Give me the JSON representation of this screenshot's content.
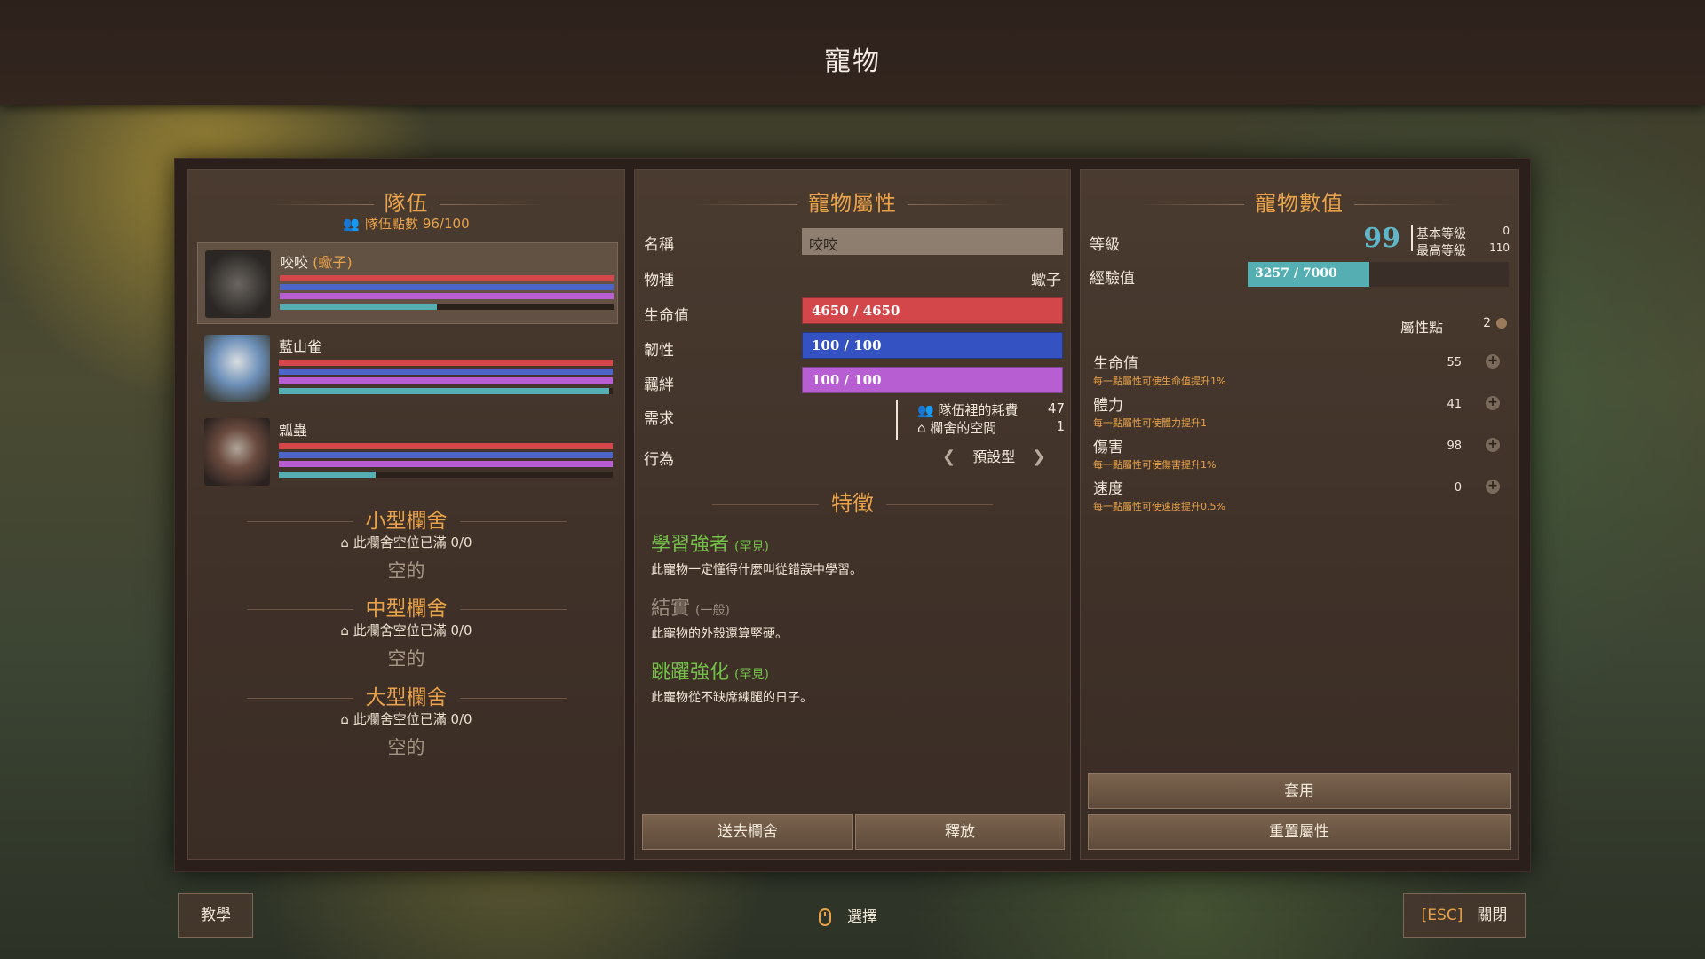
{
  "title": "寵物",
  "team": {
    "heading": "隊伍",
    "points_label": "隊伍點數",
    "points_value": "96/100",
    "pets": [
      {
        "name": "咬咬",
        "species": "(蠍子)",
        "hp": 1.0,
        "toughness": 1.0,
        "bond": 1.0,
        "xp": 0.47,
        "thumb_color": "#55504a"
      },
      {
        "name": "藍山雀",
        "species": "",
        "hp": 1.0,
        "toughness": 1.0,
        "bond": 1.0,
        "xp": 0.99,
        "thumb_color": "#6c8fb8"
      },
      {
        "name": "瓢蟲",
        "species": "",
        "hp": 1.0,
        "toughness": 1.0,
        "bond": 1.0,
        "xp": 0.29,
        "thumb_color": "#6a4a3e"
      }
    ],
    "pens": [
      {
        "title": "小型欄舍",
        "status": "此欄舍空位已滿 0/0",
        "empty": "空的"
      },
      {
        "title": "中型欄舍",
        "status": "此欄舍空位已滿 0/0",
        "empty": "空的"
      },
      {
        "title": "大型欄舍",
        "status": "此欄舍空位已滿 0/0",
        "empty": "空的"
      }
    ]
  },
  "attributes": {
    "heading": "寵物屬性",
    "name_label": "名稱",
    "name_value": "咬咬",
    "species_label": "物種",
    "species_value": "蠍子",
    "hp_label": "生命值",
    "hp_value": "4650 / 4650",
    "toughness_label": "韌性",
    "toughness_value": "100 / 100",
    "bond_label": "羈絆",
    "bond_value": "100 / 100",
    "need_label": "需求",
    "need_team_label": "隊伍裡的耗費",
    "need_team_value": "47",
    "need_pen_label": "欄舍的空間",
    "need_pen_value": "1",
    "behavior_label": "行為",
    "behavior_value": "預設型",
    "traits_heading": "特徵",
    "traits": [
      {
        "name": "學習強者",
        "rarity": "(罕見)",
        "desc": "此寵物一定懂得什麼叫從錯誤中學習。",
        "common": false
      },
      {
        "name": "結實",
        "rarity": "(一般)",
        "desc": "此寵物的外殼還算堅硬。",
        "common": true
      },
      {
        "name": "跳躍強化",
        "rarity": "(罕見)",
        "desc": "此寵物從不缺席練腿的日子。",
        "common": false
      }
    ],
    "send_to_pen": "送去欄舍",
    "release": "釋放"
  },
  "stats": {
    "heading": "寵物數值",
    "level_label": "等級",
    "level_value": "99",
    "base_level_label": "基本等級",
    "base_level_value": "0",
    "max_level_label": "最高等級",
    "max_level_value": "110",
    "xp_label": "經驗值",
    "xp_value": "3257 / 7000",
    "xp_fraction": 0.465,
    "attr_points_label": "屬性點",
    "attr_points_value": "2",
    "attrs": [
      {
        "name": "生命值",
        "hint": "每一點屬性可使生命值提升1%",
        "value": "55"
      },
      {
        "name": "體力",
        "hint": "每一點屬性可使體力提升1",
        "value": "41"
      },
      {
        "name": "傷害",
        "hint": "每一點屬性可使傷害提升1%",
        "value": "98"
      },
      {
        "name": "速度",
        "hint": "每一點屬性可使速度提升0.5%",
        "value": "0"
      }
    ],
    "apply": "套用",
    "reset": "重置屬性"
  },
  "footer": {
    "tutorial": "教學",
    "select_hint": "選擇",
    "esc_key": "[ESC]",
    "close": "關閉"
  }
}
